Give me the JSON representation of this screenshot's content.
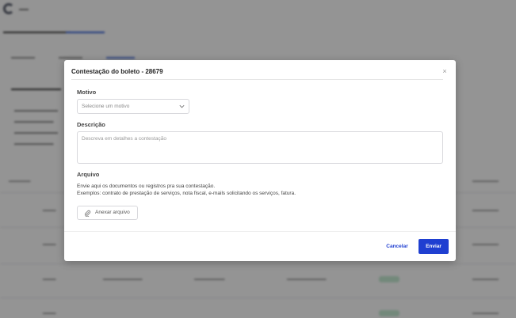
{
  "modal": {
    "title": "Contestação do boleto - 28679",
    "close_symbol": "×",
    "motivo_label": "Motivo",
    "motivo_placeholder": "Selecione um motivo",
    "descricao_label": "Descrição",
    "descricao_placeholder": "Descreva em detalhes a contestação",
    "arquivo_label": "Arquivo",
    "arquivo_help_line1": "Envie aqui os documentos ou registros pra sua contestação.",
    "arquivo_help_line2": "Exemplos: contrato de prestação de serviços, nota fiscal, e-mails solicitando os serviços, fatura.",
    "attach_label": "Anexar arquivo",
    "cancel_label": "Cancelar",
    "submit_label": "Enviar"
  },
  "colors": {
    "primary": "#1f3fd1",
    "overlay": "rgba(0,0,0,0.42)"
  },
  "icons": {
    "close": "close-icon",
    "chevron": "chevron-down-icon",
    "attach": "paperclip-icon"
  }
}
